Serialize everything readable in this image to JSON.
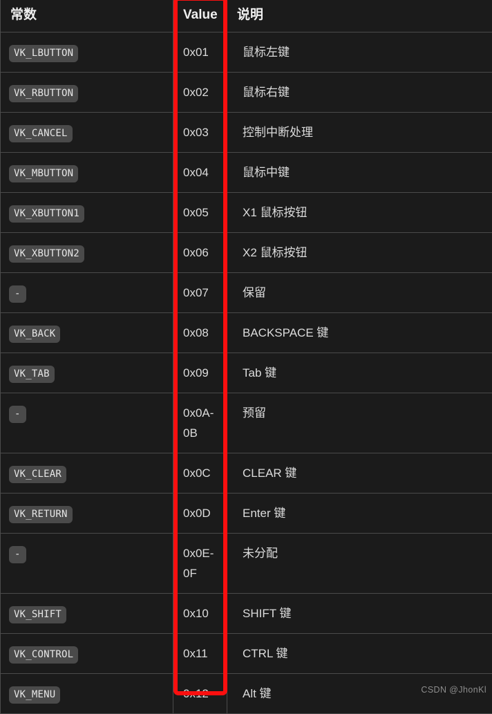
{
  "table": {
    "columns": [
      "常数",
      "Value",
      "说明"
    ],
    "rows": [
      {
        "constant": "VK_LBUTTON",
        "value": "0x01",
        "description": "鼠标左键"
      },
      {
        "constant": "VK_RBUTTON",
        "value": "0x02",
        "description": "鼠标右键"
      },
      {
        "constant": "VK_CANCEL",
        "value": "0x03",
        "description": "控制中断处理"
      },
      {
        "constant": "VK_MBUTTON",
        "value": "0x04",
        "description": "鼠标中键"
      },
      {
        "constant": "VK_XBUTTON1",
        "value": "0x05",
        "description": "X1 鼠标按钮"
      },
      {
        "constant": "VK_XBUTTON2",
        "value": "0x06",
        "description": "X2 鼠标按钮"
      },
      {
        "constant": "-",
        "value": "0x07",
        "description": "保留"
      },
      {
        "constant": "VK_BACK",
        "value": "0x08",
        "description": "BACKSPACE 键"
      },
      {
        "constant": "VK_TAB",
        "value": "0x09",
        "description": "Tab 键"
      },
      {
        "constant": "-",
        "value": "0x0A-0B",
        "description": "预留"
      },
      {
        "constant": "VK_CLEAR",
        "value": "0x0C",
        "description": "CLEAR 键"
      },
      {
        "constant": "VK_RETURN",
        "value": "0x0D",
        "description": "Enter 键"
      },
      {
        "constant": "-",
        "value": "0x0E-0F",
        "description": "未分配"
      },
      {
        "constant": "VK_SHIFT",
        "value": "0x10",
        "description": "SHIFT 键"
      },
      {
        "constant": "VK_CONTROL",
        "value": "0x11",
        "description": "CTRL 键"
      },
      {
        "constant": "VK_MENU",
        "value": "0x12",
        "description": "Alt 键"
      }
    ]
  },
  "annotation": {
    "highlight_color": "#fb0f0f",
    "highlighted_column": "Value"
  },
  "watermark": {
    "text": "CSDN @JhonKl"
  },
  "theme": {
    "background": "#1b1b1b",
    "border": "#4b4b4b",
    "text": "#e0e0e0",
    "code_badge_background": "#4a4a4a"
  }
}
